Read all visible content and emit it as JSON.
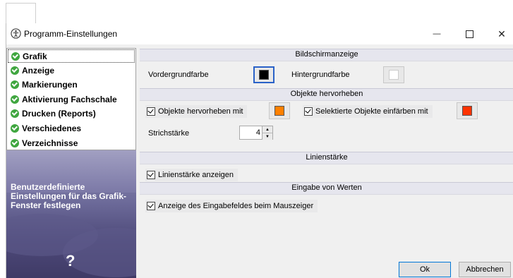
{
  "window": {
    "title": "Programm-Einstellungen",
    "controls": {
      "minimize": "—",
      "close": "✕"
    }
  },
  "nav": {
    "items": [
      {
        "label": "Grafik",
        "selected": true
      },
      {
        "label": "Anzeige"
      },
      {
        "label": "Markierungen"
      },
      {
        "label": "Aktivierung Fachschale"
      },
      {
        "label": "Drucken (Reports)"
      },
      {
        "label": "Verschiedenes"
      },
      {
        "label": "Verzeichnisse"
      }
    ]
  },
  "banner": {
    "text": "Benutzerdefinierte Einstellungen für das Grafik-Fenster festlegen",
    "help": "?"
  },
  "sections": {
    "display": {
      "header": "Bildschirmanzeige",
      "foreground_label": "Vordergrundfarbe",
      "foreground_color": "#000000",
      "background_label": "Hintergrundfarbe",
      "background_color": "#ffffff"
    },
    "highlight": {
      "header": "Objekte hervorheben",
      "highlight_checkbox": "Objekte hervorheben mit",
      "highlight_checked": true,
      "highlight_color": "#ff8000",
      "selected_checkbox": "Selektierte Objekte einfärben mit",
      "selected_checked": true,
      "selected_color": "#ff3300",
      "stroke_label": "Strichstärke",
      "stroke_value": "4"
    },
    "linewidth": {
      "header": "Linienstärke",
      "show_checkbox": "Linienstärke anzeigen",
      "show_checked": true
    },
    "input": {
      "header": "Eingabe von Werten",
      "show_checkbox": "Anzeige des Eingabefeldes beim Mauszeiger",
      "show_checked": true
    }
  },
  "buttons": {
    "ok": "Ok",
    "cancel": "Abbrechen"
  }
}
